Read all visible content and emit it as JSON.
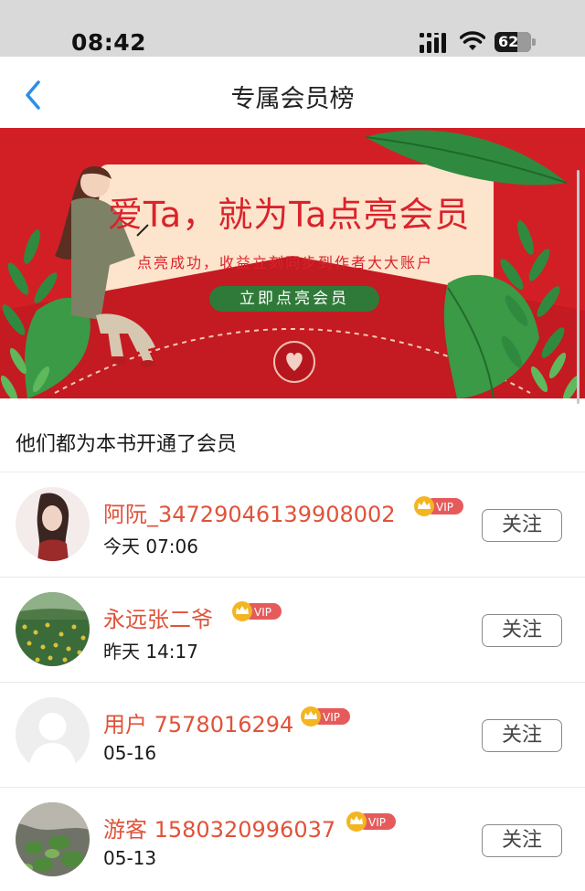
{
  "status_bar": {
    "time": "08:42",
    "battery": "62"
  },
  "nav": {
    "title": "专属会员榜",
    "back_icon": "chevron-left-icon"
  },
  "banner": {
    "headline": "爱Ta，就为Ta点亮会员",
    "subtitle": "点亮成功，收益立刻同步到作者大大账户",
    "cta": "立即点亮会员",
    "colors": {
      "background": "#d21f26",
      "card": "#fde4cc",
      "cta": "#2f7a39"
    }
  },
  "section_title": "他们都为本书开通了会员",
  "vip_label": "VIP",
  "members": [
    {
      "name": "阿阮_34729046139908002",
      "time": "今天 07:06",
      "follow": "关注",
      "avatar": "woman-portrait"
    },
    {
      "name": "永远张二爷",
      "time": "昨天 14:17",
      "follow": "关注",
      "avatar": "field-of-flowers"
    },
    {
      "name": "用户 7578016294",
      "time": "05-16",
      "follow": "关注",
      "avatar": "default-user-silhouette"
    },
    {
      "name": "游客 1580320996037",
      "time": "05-13",
      "follow": "关注",
      "avatar": "garden-plants"
    }
  ],
  "colors": {
    "name_accent": "#e0533a",
    "vip_red": "#e55b5b",
    "crown_gold": "#f3b521"
  }
}
